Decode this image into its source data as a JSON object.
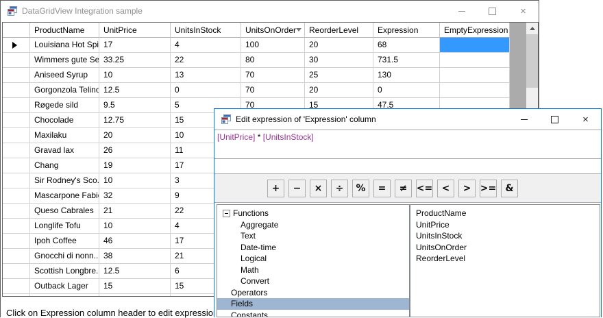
{
  "colors": {
    "accent_border": "#0078D7",
    "selected_cell": "#3399FF",
    "tree_selection": "#9FB6D2",
    "expression_field": "#993399",
    "grid_background": "#ABABAB"
  },
  "main_window": {
    "title": "DataGridView Integration sample",
    "status_text": "Click on Expression column header to edit expression",
    "grid": {
      "columns": [
        "ProductName",
        "UnitPrice",
        "UnitsInStock",
        "UnitsOnOrder",
        "ReorderLevel",
        "Expression",
        "EmptyExpression"
      ],
      "sorted_column": "UnitsOnOrder",
      "sort_direction": "descending",
      "current_row": 0,
      "selected_cell": {
        "row": 0,
        "column": "EmptyExpression"
      },
      "rows": [
        [
          "Louisiana Hot Spi...",
          "17",
          "4",
          "100",
          "20",
          "68",
          ""
        ],
        [
          "Wimmers gute Se...",
          "33.25",
          "22",
          "80",
          "30",
          "731.5",
          ""
        ],
        [
          "Aniseed Syrup",
          "10",
          "13",
          "70",
          "25",
          "130",
          ""
        ],
        [
          "Gorgonzola Telino",
          "12.5",
          "0",
          "70",
          "20",
          "0",
          ""
        ],
        [
          "Røgede sild",
          "9.5",
          "5",
          "70",
          "15",
          "47.5",
          ""
        ],
        [
          "Chocolade",
          "12.75",
          "15",
          "",
          "",
          "",
          ""
        ],
        [
          "Maxilaku",
          "20",
          "10",
          "",
          "",
          "",
          ""
        ],
        [
          "Gravad lax",
          "26",
          "11",
          "",
          "",
          "",
          ""
        ],
        [
          "Chang",
          "19",
          "17",
          "",
          "",
          "",
          ""
        ],
        [
          "Sir Rodney's Sco...",
          "10",
          "3",
          "",
          "",
          "",
          ""
        ],
        [
          "Mascarpone Fabioli",
          "32",
          "9",
          "",
          "",
          "",
          ""
        ],
        [
          "Queso Cabrales",
          "21",
          "22",
          "",
          "",
          "",
          ""
        ],
        [
          "Longlife Tofu",
          "10",
          "4",
          "",
          "",
          "",
          ""
        ],
        [
          "Ipoh Coffee",
          "46",
          "17",
          "",
          "",
          "",
          ""
        ],
        [
          "Gnocchi di nonn...",
          "38",
          "21",
          "",
          "",
          "",
          ""
        ],
        [
          "Scottish Longbre...",
          "12.5",
          "6",
          "",
          "",
          "",
          ""
        ],
        [
          "Outback Lager",
          "15",
          "15",
          "",
          "",
          "",
          ""
        ],
        [
          "",
          "",
          "",
          "",
          "",
          "",
          ""
        ]
      ]
    }
  },
  "dialog": {
    "title": "Edit expression of 'Expression' column",
    "expression_tokens": [
      {
        "text": "[UnitPrice]",
        "color": "field"
      },
      {
        "text": " * ",
        "color": "plain"
      },
      {
        "text": "[UnitsInStock]",
        "color": "field"
      }
    ],
    "operator_buttons": [
      "+",
      "−",
      "×",
      "÷",
      "%",
      "=",
      "≠",
      "<=",
      "<",
      ">",
      ">=",
      "&"
    ],
    "tree_items": [
      {
        "label": "Functions",
        "level": 0,
        "expander": true,
        "selected": false
      },
      {
        "label": "Aggregate",
        "level": 1,
        "expander": false,
        "selected": false
      },
      {
        "label": "Text",
        "level": 1,
        "expander": false,
        "selected": false
      },
      {
        "label": "Date-time",
        "level": 1,
        "expander": false,
        "selected": false
      },
      {
        "label": "Logical",
        "level": 1,
        "expander": false,
        "selected": false
      },
      {
        "label": "Math",
        "level": 1,
        "expander": false,
        "selected": false
      },
      {
        "label": "Convert",
        "level": 1,
        "expander": false,
        "selected": false
      },
      {
        "label": "Operators",
        "level": 0,
        "expander": false,
        "selected": false
      },
      {
        "label": "Fields",
        "level": 0,
        "expander": false,
        "selected": true
      },
      {
        "label": "Constants",
        "level": 0,
        "expander": false,
        "selected": false
      }
    ],
    "fields_list": [
      "ProductName",
      "UnitPrice",
      "UnitsInStock",
      "UnitsOnOrder",
      "ReorderLevel"
    ]
  }
}
